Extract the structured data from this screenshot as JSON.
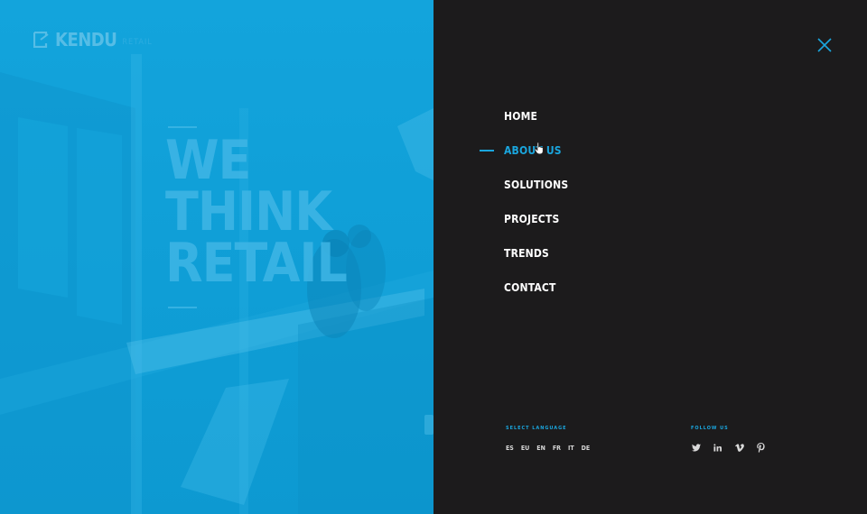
{
  "brand": {
    "name": "KENDU",
    "sub": "RETAIL"
  },
  "hero": {
    "lines": [
      "WE",
      "THINK",
      "RETAIL"
    ]
  },
  "nav": {
    "items": [
      {
        "label": "HOME",
        "active": false
      },
      {
        "label": "ABOUT US",
        "active": true
      },
      {
        "label": "SOLUTIONS",
        "active": false
      },
      {
        "label": "PROJECTS",
        "active": false
      },
      {
        "label": "TRENDS",
        "active": false
      },
      {
        "label": "CONTACT",
        "active": false
      }
    ]
  },
  "language": {
    "label": "SELECT LANGUAGE",
    "options": [
      "ES",
      "EU",
      "EN",
      "FR",
      "IT",
      "DE"
    ]
  },
  "follow": {
    "label": "FOLLOW US",
    "icons": [
      "twitter-icon",
      "linkedin-icon",
      "vimeo-icon",
      "pinterest-icon"
    ]
  },
  "colors": {
    "accent": "#1aa6de",
    "panel": "#1c1b1c",
    "hero": "#13a4dc"
  }
}
